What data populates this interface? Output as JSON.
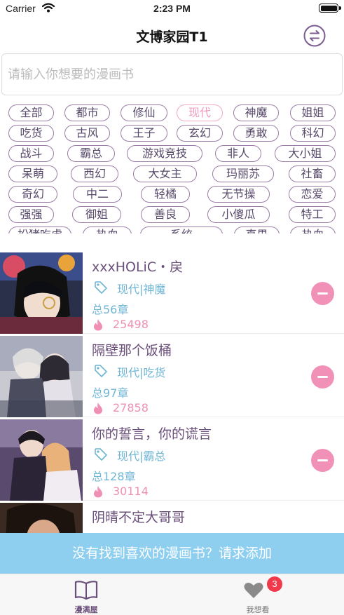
{
  "status": {
    "carrier": "Carrier",
    "time": "2:23 PM"
  },
  "nav": {
    "title": "文博家园T1"
  },
  "search": {
    "placeholder": "请输入你想要的漫画书"
  },
  "tags": [
    [
      "全部",
      "都市",
      "修仙",
      "现代",
      "神魔",
      "姐姐"
    ],
    [
      "吃货",
      "古风",
      "王子",
      "玄幻",
      "勇敢",
      "科幻"
    ],
    [
      "战斗",
      "霸总",
      "游戏竞技",
      "非人",
      "大小姐"
    ],
    [
      "呆萌",
      "西幻",
      "大女主",
      "玛丽苏",
      "社畜"
    ],
    [
      "奇幻",
      "中二",
      "轻橘",
      "无节操",
      "恋爱"
    ],
    [
      "强强",
      "御姐",
      "善良",
      "小傻瓜",
      "特工"
    ],
    [
      "扮猪吃虎",
      "热血",
      "系统",
      "直男",
      "热血"
    ]
  ],
  "active_tag": "现代",
  "comics": [
    {
      "title": "xxxHOLiC・戻",
      "genre": "现代|神魔",
      "chapters": "总56章",
      "popularity": "25498"
    },
    {
      "title": "隔壁那个饭桶",
      "genre": "现代|吃货",
      "chapters": "总97章",
      "popularity": "27858"
    },
    {
      "title": "你的誓言，你的谎言",
      "genre": "现代|霸总",
      "chapters": "总128章",
      "popularity": "30114"
    },
    {
      "title": "阴晴不定大哥哥",
      "genre": "",
      "chapters": "",
      "popularity": ""
    }
  ],
  "request_text": "没有找到喜欢的漫画书？请求添加",
  "tabbar": {
    "home_label": "漫满屋",
    "wish_label": "我想看",
    "wish_badge": "3"
  },
  "colors": {
    "accent_purple": "#6a4f7a",
    "tag_border": "#9a7ca6",
    "active_tag_pink": "#f09cbf",
    "info_blue": "#6fb5d4",
    "popularity_pink": "#ef8fb3",
    "remove_button": "#f291b8",
    "banner_blue": "#8ecff0",
    "badge_red": "#f0394a"
  },
  "icons": {
    "status": [
      "wifi-icon",
      "battery-icon"
    ],
    "nav": "swap-arrows-icon",
    "list": [
      "tag-icon",
      "fire-icon",
      "remove-icon"
    ],
    "tabbar": [
      "book-icon",
      "heart-icon"
    ]
  }
}
